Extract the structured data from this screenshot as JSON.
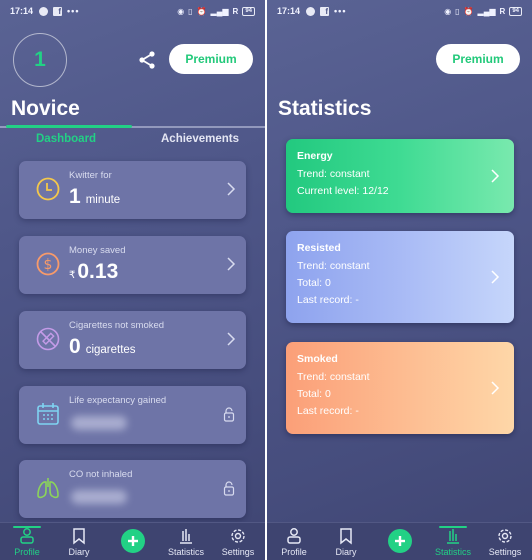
{
  "status_bar": {
    "time": "17:14",
    "left_icons": [
      "spotify-icon",
      "facebook-icon",
      "more-dots-icon"
    ],
    "right_icons": [
      "hotspot-icon",
      "vibrate-icon",
      "alarm-icon",
      "signal-icon"
    ],
    "roaming": "R",
    "battery": "94"
  },
  "colors": {
    "accent": "#22d185",
    "background": "#4e5688",
    "card": "#6e74a7",
    "energy": "#22c97f",
    "resisted": "#8ea3ee",
    "smoked": "#fb9f78"
  },
  "profile_screen": {
    "level": "1",
    "premium_label": "Premium",
    "title": "Novice",
    "tabs": [
      {
        "label": "Dashboard",
        "active": true
      },
      {
        "label": "Achievements",
        "active": false
      }
    ],
    "cards": [
      {
        "label": "Kwitter for",
        "value": "1",
        "unit": "minute",
        "icon": "clock-icon",
        "locked": false
      },
      {
        "label": "Money saved",
        "currency": "₹",
        "value": "0.13",
        "icon": "dollar-coin-icon",
        "locked": false
      },
      {
        "label": "Cigarettes not smoked",
        "value": "0",
        "unit": "cigarettes",
        "icon": "no-cigarette-icon",
        "locked": false
      },
      {
        "label": "Life expectancy gained",
        "icon": "calendar-icon",
        "locked": true
      },
      {
        "label": "CO not inhaled",
        "icon": "lungs-icon",
        "locked": true
      }
    ]
  },
  "statistics_screen": {
    "premium_label": "Premium",
    "title": "Statistics",
    "cards": [
      {
        "title": "Energy",
        "lines": [
          "Trend: constant",
          "Current level: 12/12"
        ]
      },
      {
        "title": "Resisted",
        "lines": [
          "Trend: constant",
          "Total: 0",
          "Last record: -"
        ]
      },
      {
        "title": "Smoked",
        "lines": [
          "Trend: constant",
          "Total: 0",
          "Last record: -"
        ]
      }
    ]
  },
  "bottom_nav": {
    "items": [
      {
        "label": "Profile",
        "icon": "person-icon"
      },
      {
        "label": "Diary",
        "icon": "bookmark-icon"
      },
      {
        "label": "",
        "icon": "add-icon"
      },
      {
        "label": "Statistics",
        "icon": "bar-chart-icon"
      },
      {
        "label": "Settings",
        "icon": "gear-icon"
      }
    ]
  }
}
